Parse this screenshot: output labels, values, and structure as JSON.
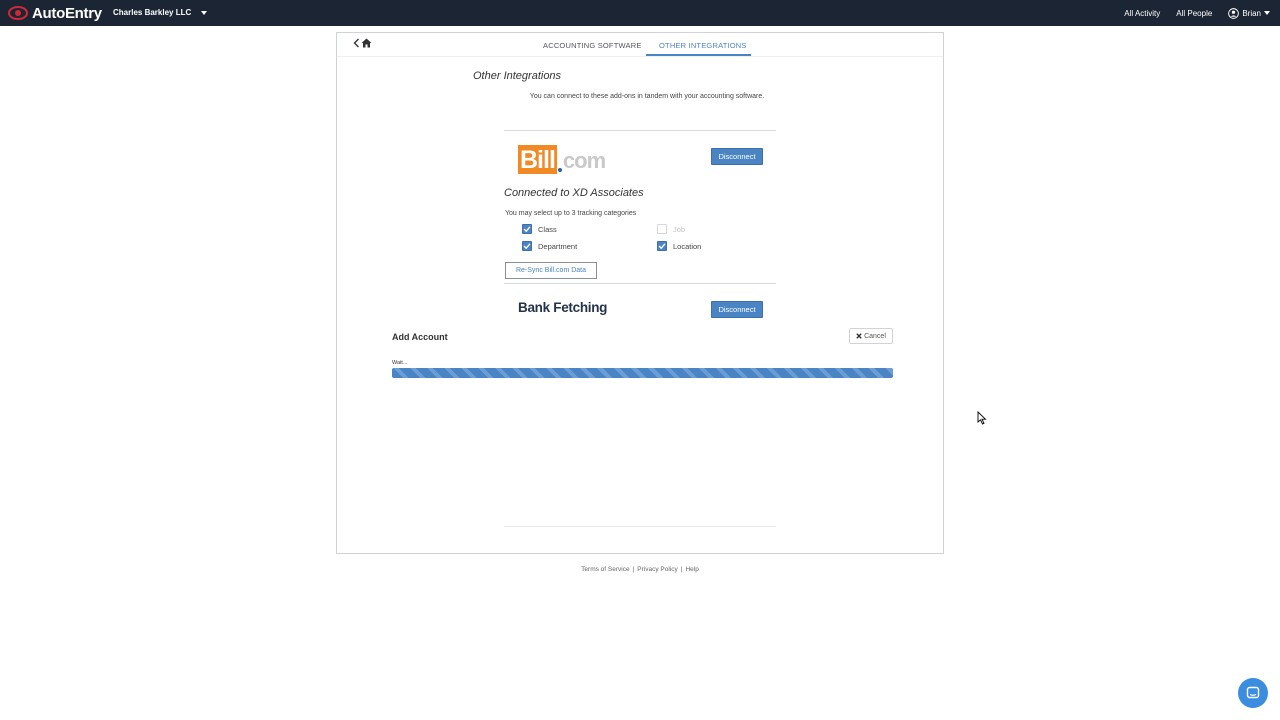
{
  "colors": {
    "nav_bg": "#1c2533",
    "accent": "#4a84c4",
    "bill_orange": "#f08a24"
  },
  "header": {
    "brand": "AutoEntry",
    "brand_icon": "autoentry-eye-logo",
    "company": "Charles Barkley LLC",
    "nav": {
      "all_activity": "All Activity",
      "all_people": "All People",
      "user": "Brian"
    }
  },
  "tabs": [
    {
      "label": "ACCOUNTING SOFTWARE",
      "active": false
    },
    {
      "label": "OTHER INTEGRATIONS",
      "active": true
    }
  ],
  "main": {
    "title": "Other Integrations",
    "subtitle": "You can connect to these add-ons in tandem with your accounting software.",
    "bill": {
      "logo_main": "Bill",
      "logo_suffix": "com",
      "disconnect_label": "Disconnect",
      "connected_text": "Connected to XD Associates",
      "tracking_note": "You may select up to 3 tracking categories",
      "categories": [
        {
          "label": "Class",
          "checked": true,
          "disabled": false
        },
        {
          "label": "Job",
          "checked": false,
          "disabled": true
        },
        {
          "label": "Department",
          "checked": true,
          "disabled": false
        },
        {
          "label": "Location",
          "checked": true,
          "disabled": false
        }
      ],
      "resync_label": "Re-Sync Bill.com Data"
    },
    "bank": {
      "title": "Bank Fetching",
      "disconnect_label": "Disconnect",
      "add_account_label": "Add Account",
      "cancel_label": "Cancel",
      "wait_label": "Wait...",
      "progress": 1.0
    }
  },
  "footer": {
    "terms": "Terms of Service",
    "privacy": "Privacy Policy",
    "help": "Help"
  }
}
